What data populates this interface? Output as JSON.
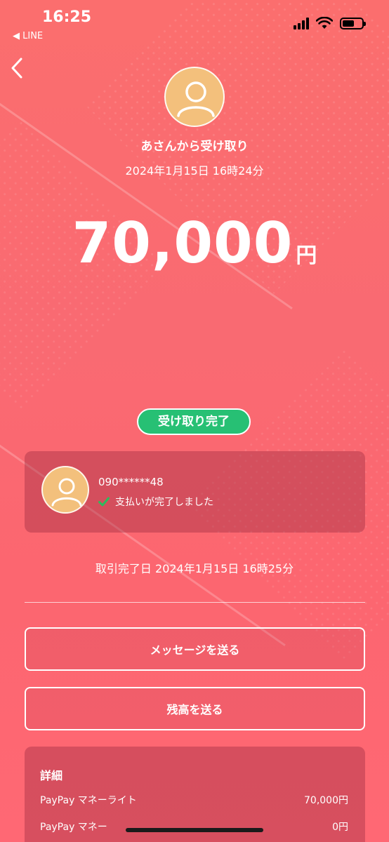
{
  "status_bar": {
    "time": "16:25",
    "back_app": "◀ LINE"
  },
  "header": {
    "from_text": "あさんから受け取り",
    "date_text": "2024年1月15日 16時24分"
  },
  "amount": {
    "value": "70,000",
    "unit": "円"
  },
  "status_badge": "受け取り完了",
  "sender": {
    "phone": "090******48",
    "payment_status": "支払いが完了しました"
  },
  "completion_date": "取引完了日 2024年1月15日 16時25分",
  "actions": {
    "send_message": "メッセージを送る",
    "send_balance": "残高を送る"
  },
  "details": {
    "title": "詳細",
    "rows": [
      {
        "label": "PayPay マネーライト",
        "value": "70,000円"
      },
      {
        "label": "PayPay マネー",
        "value": "0円"
      }
    ]
  },
  "colors": {
    "background": "#fb6e6e",
    "badge": "#27c074",
    "avatar": "#f3c07c",
    "check": "#2dbb5d"
  }
}
